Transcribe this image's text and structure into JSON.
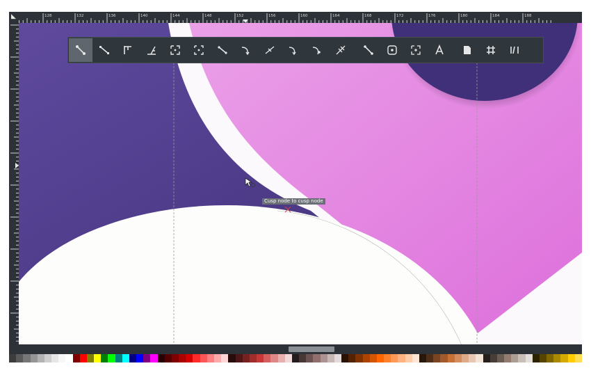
{
  "canvas": {
    "tooltip_text": "Cusp node to cusp node"
  },
  "rulers": {
    "corner_icon": "corner-toggle-icon",
    "horizontal_labels": [
      "128",
      "132",
      "136",
      "140",
      "144",
      "148",
      "152",
      "156",
      "160",
      "164",
      "168",
      "172",
      "176",
      "180",
      "184",
      "188"
    ]
  },
  "toolbar": {
    "tools": [
      {
        "icon": "node-to-node-snap-icon",
        "active": true
      },
      {
        "icon": "path-snap-icon",
        "active": false
      },
      {
        "icon": "perpendicular-snap-icon",
        "active": false
      },
      {
        "icon": "tangent-snap-icon",
        "active": false
      },
      {
        "icon": "bounding-box-snap-icon",
        "active": false
      },
      {
        "icon": "bbox-midpoint-snap-icon",
        "active": false
      },
      {
        "icon": "path-intersection-snap-icon",
        "active": false
      },
      {
        "icon": "cusp-node-snap-icon",
        "active": false
      },
      {
        "icon": "smooth-node-snap-icon",
        "active": false
      },
      {
        "icon": "line-midpoint-snap-icon",
        "active": false
      },
      {
        "icon": "object-center-snap-icon",
        "active": false
      },
      {
        "icon": "rotation-center-snap-icon",
        "active": false
      },
      {
        "icon": "text-baseline-snap-icon",
        "active": false
      },
      {
        "icon": "page-border-snap-icon",
        "active": false
      },
      {
        "icon": "grid-snap-icon",
        "active": false
      },
      {
        "icon": "guide-snap-icon",
        "active": false
      },
      {
        "icon": "text-anchor-snap-icon",
        "active": false
      },
      {
        "icon": "page-snap-icon",
        "active": false
      },
      {
        "icon": "grid-toggle-icon",
        "active": false
      },
      {
        "icon": "guides-toggle-icon",
        "active": false
      }
    ]
  },
  "palette": {
    "colors": [
      "#3c3c3c",
      "#5a5a5a",
      "#777777",
      "#959595",
      "#b3b3b3",
      "#cfcfcf",
      "#e6e6e6",
      "#f7f7f7",
      "#ffffff",
      "#800000",
      "#ff0000",
      "#808000",
      "#ffff00",
      "#008000",
      "#00ff00",
      "#008080",
      "#00ffff",
      "#000080",
      "#0000ff",
      "#800080",
      "#ff00ff",
      "#2b0000",
      "#550000",
      "#800000",
      "#aa0000",
      "#d40000",
      "#ff2a2a",
      "#ff5555",
      "#ff8080",
      "#ffaaaa",
      "#ffd5d5",
      "#280b0b",
      "#501616",
      "#782121",
      "#a02c2c",
      "#c83737",
      "#d35f5f",
      "#de8787",
      "#e9afaf",
      "#f4d7d7",
      "#241c1c",
      "#483737",
      "#6c5353",
      "#916f6f",
      "#ac9393",
      "#c8b7b7",
      "#e3dbdb",
      "#2b1100",
      "#552200",
      "#803300",
      "#aa4400",
      "#d45500",
      "#ff6600",
      "#ff7f2a",
      "#ff9955",
      "#ffb380",
      "#ffccaa",
      "#ffe6d5",
      "#28170b",
      "#502d16",
      "#784421",
      "#a05a2c",
      "#c87137",
      "#d38d5f",
      "#deaa87",
      "#e9c6af",
      "#f4e3d7",
      "#241f1c",
      "#483e37",
      "#6c5d53",
      "#917c6f",
      "#ac9d93",
      "#c8beb7",
      "#e3dedb",
      "#2b2200",
      "#554400",
      "#806600",
      "#aa8800",
      "#d4aa00",
      "#ffcc00",
      "#ffdd55"
    ]
  }
}
